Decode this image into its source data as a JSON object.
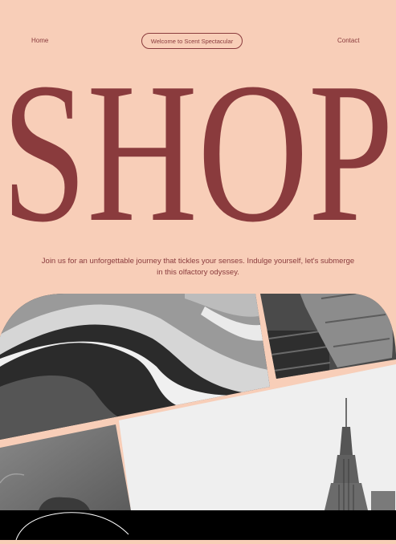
{
  "nav": {
    "home_label": "Home",
    "welcome_label": "Welcome to Scent Spectacular",
    "contact_label": "Contact"
  },
  "hero": {
    "title": "SHOP"
  },
  "intro": {
    "tagline": "Join us for an unforgettable journey that tickles your senses. Indulge yourself, let's submerge in this olfactory odyssey."
  },
  "gallery": {
    "images": [
      {
        "subject": "abstract-waves"
      },
      {
        "subject": "person-denim-jacket"
      },
      {
        "subject": "portrait"
      },
      {
        "subject": "empire-state-building"
      }
    ]
  },
  "colors": {
    "background": "#f8ceb8",
    "accent": "#8a3b3d",
    "footer": "#000000"
  }
}
